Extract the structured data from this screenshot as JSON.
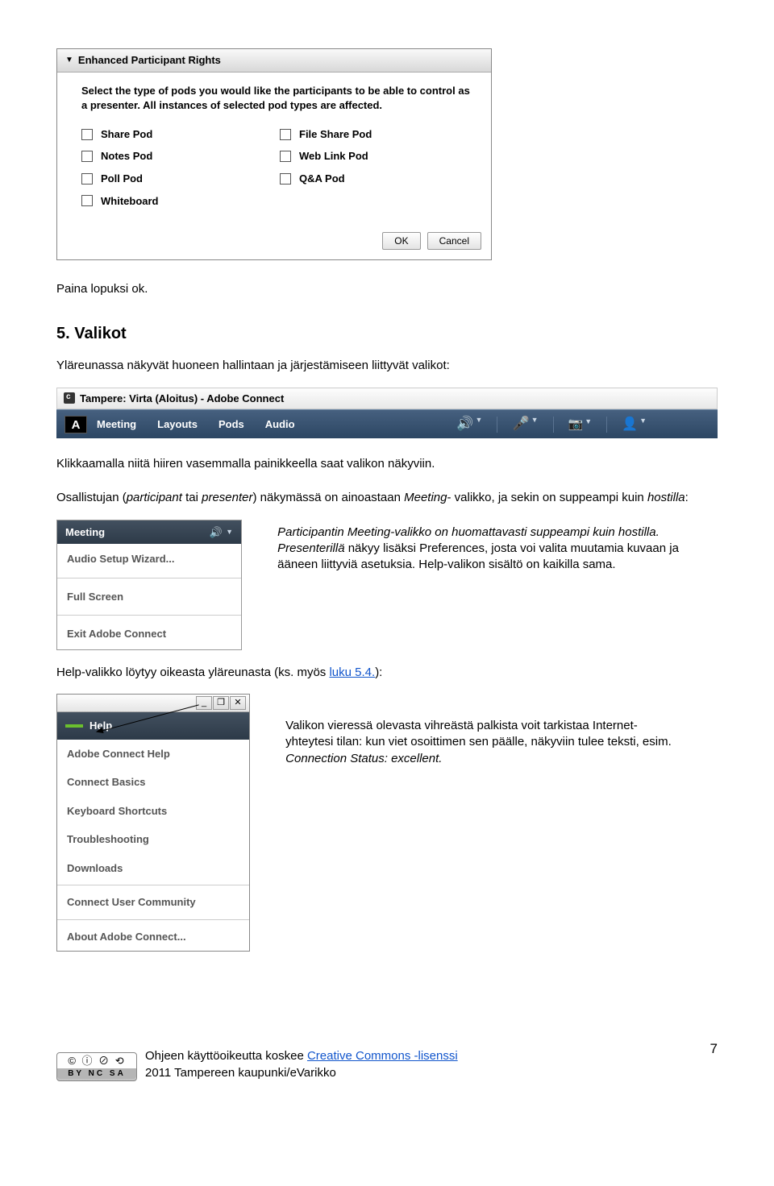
{
  "dialog": {
    "title": "Enhanced Participant Rights",
    "desc": "Select the type of pods you would like the participants to be able to control as a presenter. All instances of selected pod types are affected.",
    "pods_left": [
      "Share Pod",
      "Notes Pod",
      "Poll Pod",
      "Whiteboard"
    ],
    "pods_right": [
      "File Share Pod",
      "Web Link Pod",
      "Q&A Pod"
    ],
    "ok": "OK",
    "cancel": "Cancel"
  },
  "t1": "Paina lopuksi ok.",
  "h1": "5. Valikot",
  "t2": "Yläreunassa näkyvät huoneen hallintaan ja järjestämiseen liittyvät valikot:",
  "toolbar": {
    "title": "Tampere: Virta (Aloitus) - Adobe Connect",
    "items": [
      "Meeting",
      "Layouts",
      "Pods",
      "Audio"
    ]
  },
  "t3": "Klikkaamalla niitä hiiren vasemmalla painikkeella saat valikon näkyviin.",
  "t4a": "Osallistujan (",
  "t4b": "participant",
  "t4c": " tai ",
  "t4d": "presenter",
  "t4e": ") näkymässä on ainoastaan ",
  "t4f": "Meeting",
  "t4g": "- valikko, ja sekin on suppeampi kuin ",
  "t4h": "hostilla",
  "t4i": ":",
  "mp": {
    "head": "Meeting",
    "i1": "Audio Setup Wizard...",
    "i2": "Full Screen",
    "i3": "Exit Adobe Connect"
  },
  "side1a": "Participantin Meeting-valikko on huomattavasti suppeampi kuin hostilla. Presenterillä ",
  "side1b": "näkyy lisäksi ",
  "side1c": "Preferences",
  "side1d": ", josta voi valita muutamia kuvaan ja ääneen liittyviä asetuksia. ",
  "side1e": "Help",
  "side1f": "-valikon sisältö on kaikilla sama.",
  "t5a": "Help-valikko löytyy oikeasta yläreunasta (ks. myös ",
  "t5b": "luku 5.4.",
  "t5c": "):",
  "help": {
    "label": "Help",
    "i1": "Adobe Connect Help",
    "i2": "Connect Basics",
    "i3": "Keyboard Shortcuts",
    "i4": "Troubleshooting",
    "i5": "Downloads",
    "i6": "Connect User Community",
    "i7": "About Adobe Connect..."
  },
  "side2a": "Valikon vieressä olevasta vihreästä palkista voit tarkistaa Internet-yhteytesi tilan: kun viet osoittimen sen päälle, näkyviin tulee teksti, esim. ",
  "side2b": "Connection Status: excellent.",
  "footer": {
    "cc": "BY   NC   SA",
    "t1": "Ohjeen käyttöoikeutta koskee ",
    "link": "Creative Commons -lisenssi",
    "t2": "2011 Tampereen kaupunki/eVarikko",
    "page": "7"
  }
}
